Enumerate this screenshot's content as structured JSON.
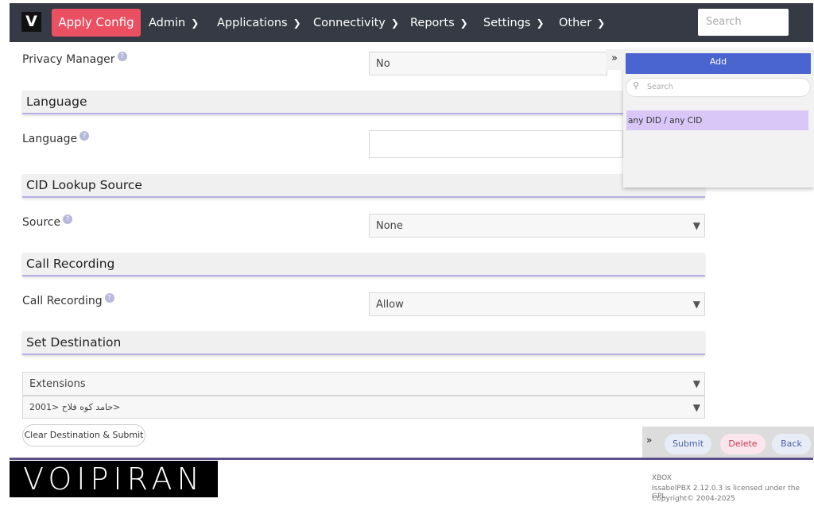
{
  "nav": {
    "logo": "V",
    "apply_config": "Apply Config",
    "menu": [
      "Admin",
      "Applications",
      "Connectivity",
      "Reports",
      "Settings",
      "Other"
    ],
    "search_placeholder": "Search"
  },
  "form": {
    "privacy_manager": {
      "label": "Privacy Manager",
      "value": "No"
    },
    "language_section": "Language",
    "language": {
      "label": "Language",
      "value": ""
    },
    "cid_section": "CID Lookup Source",
    "source": {
      "label": "Source",
      "value": "None"
    },
    "recording_section": "Call Recording",
    "call_recording": {
      "label": "Call Recording",
      "value": "Allow"
    },
    "destination_section": "Set Destination",
    "destination_type": "Extensions",
    "destination_value": "حامد کوه فلاح <2001>",
    "clear_button": "Clear Destination & Submit",
    "help_glyph": "?"
  },
  "right_panel": {
    "toggle": "»",
    "add_label": "Add",
    "search_placeholder": "Search",
    "items": [
      "any DID / any CID"
    ]
  },
  "action_bar": {
    "toggle": "»",
    "submit": "Submit",
    "delete": "Delete",
    "back": "Back"
  },
  "footer": {
    "brand": "VOIPIRAN",
    "line1": "XBOX",
    "line2": "IssabelPBX 2.12.0.3 is licensed under the GPL",
    "line3": "Copyright© 2004-2025"
  },
  "colors": {
    "nav_bg": "#353a44",
    "apply": "#ea4f62",
    "add": "#4a64d0",
    "selected_item": "#d9c8f7",
    "section_underline": "#b4b0e6",
    "footer_line": "#5c4e8c"
  },
  "icons": [
    "chevron-down-icon",
    "help-icon",
    "search-icon",
    "double-chevron-right-icon",
    "dropdown-arrow-icon"
  ]
}
